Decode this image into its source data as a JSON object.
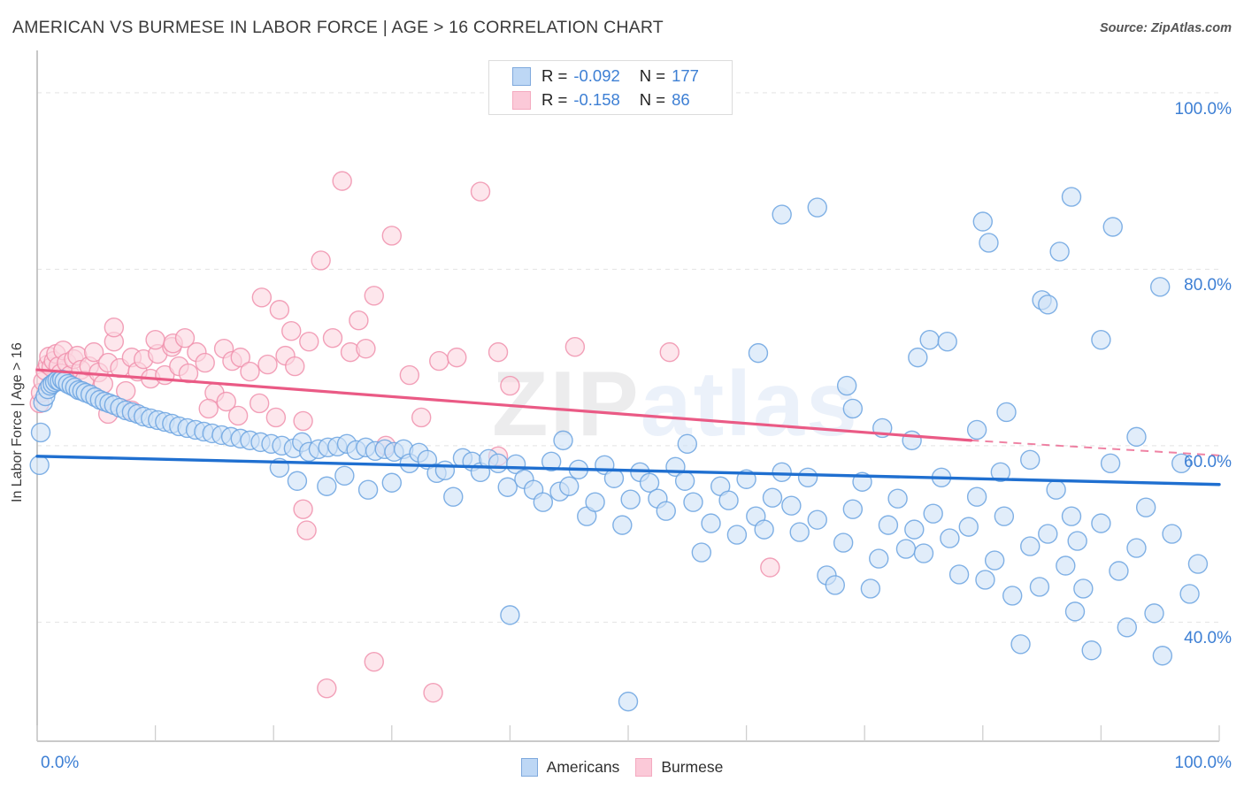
{
  "header": {
    "title": "AMERICAN VS BURMESE IN LABOR FORCE | AGE > 16 CORRELATION CHART",
    "source": "Source: ZipAtlas.com"
  },
  "watermark": {
    "zip": "ZIP",
    "atlas": "atlas"
  },
  "axes": {
    "y_title": "In Labor Force | Age > 16",
    "x_min_label": "0.0%",
    "x_max_label": "100.0%",
    "y_tick_labels": [
      "100.0%",
      "80.0%",
      "60.0%",
      "40.0%"
    ]
  },
  "stats_legend": {
    "r_label": "R =",
    "n_label": "N =",
    "rows": [
      {
        "series": "Americans",
        "color": "#bdd7f5",
        "r": "-0.092",
        "n": "177"
      },
      {
        "series": "Burmese",
        "color": "#fbc9d8",
        "r": "-0.158",
        "n": "86"
      }
    ]
  },
  "series_legend": [
    {
      "label": "Americans",
      "color": "#bdd7f5"
    },
    {
      "label": "Burmese",
      "color": "#fbc9d8"
    }
  ],
  "colors": {
    "blue_fill": "#cfe2f7",
    "blue_stroke": "#6ba3e0",
    "pink_fill": "#fbd6e0",
    "pink_stroke": "#f090ad",
    "blue_trend": "#1f6fd0",
    "pink_trend": "#ea5a85",
    "axis_text": "#3d7fd4",
    "gridline": "#e3e3e3"
  },
  "chart_data": {
    "type": "scatter",
    "title": "AMERICAN VS BURMESE IN LABOR FORCE | AGE > 16 CORRELATION CHART",
    "xlabel": "",
    "ylabel": "In Labor Force | Age > 16",
    "xlim": [
      0,
      100
    ],
    "ylim": [
      26.5,
      104.5
    ],
    "xticks": [
      0,
      100
    ],
    "yticks": [
      40,
      60,
      80,
      100
    ],
    "grid": "horizontal-dashed",
    "legend_position": "bottom-center",
    "series": [
      {
        "name": "Americans",
        "color": "#cfe2f7",
        "stroke": "#6ba3e0",
        "r": -0.092,
        "n": 177,
        "trendline": {
          "x0": 0,
          "y0": 58.8,
          "x1": 100,
          "y1": 55.6,
          "style": "solid"
        },
        "points": [
          [
            0.2,
            57.8
          ],
          [
            0.3,
            61.5
          ],
          [
            0.5,
            64.9
          ],
          [
            0.7,
            65.6
          ],
          [
            0.9,
            66.4
          ],
          [
            1.1,
            66.8
          ],
          [
            1.3,
            67.0
          ],
          [
            1.5,
            67.2
          ],
          [
            1.7,
            67.4
          ],
          [
            1.9,
            67.3
          ],
          [
            2.1,
            67.5
          ],
          [
            2.3,
            67.3
          ],
          [
            2.6,
            67.0
          ],
          [
            2.9,
            66.8
          ],
          [
            3.2,
            66.6
          ],
          [
            3.5,
            66.3
          ],
          [
            3.8,
            66.2
          ],
          [
            4.1,
            66.0
          ],
          [
            4.5,
            65.8
          ],
          [
            4.9,
            65.5
          ],
          [
            5.3,
            65.2
          ],
          [
            5.7,
            65.0
          ],
          [
            6.1,
            64.8
          ],
          [
            6.5,
            64.6
          ],
          [
            7.0,
            64.3
          ],
          [
            7.5,
            64.0
          ],
          [
            8.0,
            63.8
          ],
          [
            8.5,
            63.6
          ],
          [
            9.0,
            63.3
          ],
          [
            9.6,
            63.1
          ],
          [
            10.2,
            62.9
          ],
          [
            10.8,
            62.7
          ],
          [
            11.4,
            62.5
          ],
          [
            12.0,
            62.2
          ],
          [
            12.7,
            62.0
          ],
          [
            13.4,
            61.8
          ],
          [
            14.1,
            61.6
          ],
          [
            14.8,
            61.4
          ],
          [
            15.6,
            61.2
          ],
          [
            16.4,
            61.0
          ],
          [
            17.2,
            60.8
          ],
          [
            18.0,
            60.6
          ],
          [
            18.9,
            60.4
          ],
          [
            19.8,
            60.2
          ],
          [
            20.7,
            60.0
          ],
          [
            21.7,
            59.7
          ],
          [
            22.4,
            60.4
          ],
          [
            23.0,
            59.3
          ],
          [
            23.8,
            59.6
          ],
          [
            24.6,
            59.8
          ],
          [
            25.4,
            59.9
          ],
          [
            26.2,
            60.2
          ],
          [
            27.0,
            59.5
          ],
          [
            27.8,
            59.8
          ],
          [
            28.6,
            59.4
          ],
          [
            29.4,
            59.6
          ],
          [
            30.2,
            59.3
          ],
          [
            31.0,
            59.6
          ],
          [
            20.5,
            57.5
          ],
          [
            22.0,
            56.0
          ],
          [
            24.5,
            55.4
          ],
          [
            26.0,
            56.6
          ],
          [
            28.0,
            55.0
          ],
          [
            30.0,
            55.8
          ],
          [
            31.5,
            58.0
          ],
          [
            32.3,
            59.2
          ],
          [
            33.0,
            58.4
          ],
          [
            33.8,
            56.9
          ],
          [
            34.5,
            57.2
          ],
          [
            35.2,
            54.2
          ],
          [
            36.0,
            58.6
          ],
          [
            36.8,
            58.2
          ],
          [
            37.5,
            57.0
          ],
          [
            38.2,
            58.5
          ],
          [
            39.0,
            58.0
          ],
          [
            39.8,
            55.3
          ],
          [
            40.5,
            57.9
          ],
          [
            41.2,
            56.2
          ],
          [
            42.0,
            55.0
          ],
          [
            42.8,
            53.6
          ],
          [
            43.5,
            58.2
          ],
          [
            44.2,
            54.8
          ],
          [
            45.0,
            55.4
          ],
          [
            45.8,
            57.3
          ],
          [
            46.5,
            52.0
          ],
          [
            47.2,
            53.6
          ],
          [
            48.0,
            57.8
          ],
          [
            48.8,
            56.3
          ],
          [
            49.5,
            51.0
          ],
          [
            50.2,
            53.9
          ],
          [
            51.0,
            57.0
          ],
          [
            51.8,
            55.8
          ],
          [
            52.5,
            54.0
          ],
          [
            53.2,
            52.6
          ],
          [
            54.0,
            57.6
          ],
          [
            54.8,
            56.0
          ],
          [
            55.5,
            53.6
          ],
          [
            56.2,
            47.9
          ],
          [
            57.0,
            51.2
          ],
          [
            57.8,
            55.4
          ],
          [
            58.5,
            53.8
          ],
          [
            59.2,
            49.9
          ],
          [
            60.0,
            56.2
          ],
          [
            60.8,
            52.0
          ],
          [
            61.5,
            50.5
          ],
          [
            62.2,
            54.1
          ],
          [
            63.0,
            57.0
          ],
          [
            63.8,
            53.2
          ],
          [
            64.5,
            50.2
          ],
          [
            65.2,
            56.4
          ],
          [
            66.0,
            51.6
          ],
          [
            66.8,
            45.3
          ],
          [
            67.5,
            44.2
          ],
          [
            68.2,
            49.0
          ],
          [
            69.0,
            52.8
          ],
          [
            69.8,
            55.9
          ],
          [
            70.5,
            43.8
          ],
          [
            71.2,
            47.2
          ],
          [
            72.0,
            51.0
          ],
          [
            72.8,
            54.0
          ],
          [
            73.5,
            48.3
          ],
          [
            74.2,
            50.5
          ],
          [
            75.0,
            47.8
          ],
          [
            75.8,
            52.3
          ],
          [
            76.5,
            56.4
          ],
          [
            77.2,
            49.5
          ],
          [
            78.0,
            45.4
          ],
          [
            78.8,
            50.8
          ],
          [
            79.5,
            54.2
          ],
          [
            80.2,
            44.8
          ],
          [
            81.0,
            47.0
          ],
          [
            81.8,
            52.0
          ],
          [
            82.5,
            43.0
          ],
          [
            83.2,
            37.5
          ],
          [
            84.0,
            48.6
          ],
          [
            84.8,
            44.0
          ],
          [
            85.5,
            50.0
          ],
          [
            86.2,
            55.0
          ],
          [
            87.0,
            46.4
          ],
          [
            87.8,
            41.2
          ],
          [
            88.5,
            43.8
          ],
          [
            89.2,
            36.8
          ],
          [
            90.0,
            51.2
          ],
          [
            90.8,
            58.0
          ],
          [
            91.5,
            45.8
          ],
          [
            92.2,
            39.4
          ],
          [
            93.0,
            48.4
          ],
          [
            93.8,
            53.0
          ],
          [
            94.5,
            41.0
          ],
          [
            95.2,
            36.2
          ],
          [
            96.0,
            50.0
          ],
          [
            96.8,
            58.0
          ],
          [
            97.5,
            43.2
          ],
          [
            98.2,
            46.6
          ],
          [
            61.0,
            70.5
          ],
          [
            63.0,
            86.2
          ],
          [
            66.0,
            87.0
          ],
          [
            68.5,
            66.8
          ],
          [
            69.0,
            64.2
          ],
          [
            71.5,
            62.0
          ],
          [
            74.5,
            70.0
          ],
          [
            75.5,
            72.0
          ],
          [
            77.0,
            71.8
          ],
          [
            80.0,
            85.4
          ],
          [
            80.5,
            83.0
          ],
          [
            82.0,
            63.8
          ],
          [
            85.0,
            76.5
          ],
          [
            85.5,
            76.0
          ],
          [
            86.5,
            82.0
          ],
          [
            87.5,
            88.2
          ],
          [
            90.0,
            72.0
          ],
          [
            91.0,
            84.8
          ],
          [
            93.0,
            61.0
          ],
          [
            95.0,
            78.0
          ],
          [
            40.0,
            40.8
          ],
          [
            50.0,
            31.0
          ],
          [
            87.5,
            52.0
          ],
          [
            88.0,
            49.2
          ],
          [
            74.0,
            60.6
          ],
          [
            79.5,
            61.8
          ],
          [
            81.5,
            57.0
          ],
          [
            84.0,
            58.4
          ],
          [
            55.0,
            60.2
          ],
          [
            44.5,
            60.6
          ]
        ]
      },
      {
        "name": "Burmese",
        "color": "#fbd6e0",
        "stroke": "#f090ad",
        "r": -0.158,
        "n": 86,
        "trendline": {
          "x0": 0,
          "y0": 68.6,
          "x1": 79,
          "y1": 60.6,
          "style": "solid-then-dashed",
          "dash_from_x": 79,
          "dash_to_x": 100,
          "dash_y1": 58.9
        },
        "points": [
          [
            0.2,
            64.8
          ],
          [
            0.3,
            66.0
          ],
          [
            0.5,
            67.3
          ],
          [
            0.7,
            68.5
          ],
          [
            0.9,
            69.2
          ],
          [
            1.0,
            70.1
          ],
          [
            1.2,
            68.9
          ],
          [
            1.4,
            69.6
          ],
          [
            1.6,
            70.4
          ],
          [
            1.8,
            69.0
          ],
          [
            2.0,
            68.2
          ],
          [
            2.2,
            70.8
          ],
          [
            2.5,
            69.4
          ],
          [
            2.8,
            68.0
          ],
          [
            3.1,
            69.8
          ],
          [
            3.4,
            70.2
          ],
          [
            3.7,
            68.6
          ],
          [
            4.0,
            67.4
          ],
          [
            4.4,
            69.0
          ],
          [
            4.8,
            70.6
          ],
          [
            5.2,
            68.3
          ],
          [
            5.6,
            67.0
          ],
          [
            6.0,
            69.4
          ],
          [
            6.5,
            71.8
          ],
          [
            7.0,
            68.8
          ],
          [
            7.5,
            66.2
          ],
          [
            8.0,
            70.0
          ],
          [
            8.5,
            68.4
          ],
          [
            9.0,
            69.8
          ],
          [
            9.6,
            67.6
          ],
          [
            10.2,
            70.4
          ],
          [
            10.8,
            68.0
          ],
          [
            11.4,
            71.2
          ],
          [
            12.0,
            69.0
          ],
          [
            12.8,
            68.2
          ],
          [
            13.5,
            70.6
          ],
          [
            14.2,
            69.4
          ],
          [
            15.0,
            66.0
          ],
          [
            15.8,
            71.0
          ],
          [
            16.5,
            69.6
          ],
          [
            17.2,
            70.0
          ],
          [
            18.0,
            68.4
          ],
          [
            18.8,
            64.8
          ],
          [
            19.5,
            69.2
          ],
          [
            20.2,
            63.2
          ],
          [
            21.0,
            70.2
          ],
          [
            21.8,
            69.0
          ],
          [
            22.5,
            62.8
          ],
          [
            6.5,
            73.4
          ],
          [
            10.0,
            72.0
          ],
          [
            11.5,
            71.6
          ],
          [
            12.5,
            72.2
          ],
          [
            19.0,
            76.8
          ],
          [
            20.5,
            75.4
          ],
          [
            21.5,
            73.0
          ],
          [
            23.0,
            71.8
          ],
          [
            24.0,
            81.0
          ],
          [
            25.0,
            72.2
          ],
          [
            25.8,
            90.0
          ],
          [
            26.5,
            70.6
          ],
          [
            27.2,
            74.2
          ],
          [
            27.8,
            71.0
          ],
          [
            28.5,
            77.0
          ],
          [
            30.0,
            83.8
          ],
          [
            31.5,
            68.0
          ],
          [
            32.5,
            63.2
          ],
          [
            34.0,
            69.6
          ],
          [
            35.5,
            70.0
          ],
          [
            37.5,
            88.8
          ],
          [
            39.0,
            70.6
          ],
          [
            40.0,
            66.8
          ],
          [
            45.5,
            71.2
          ],
          [
            53.5,
            70.6
          ],
          [
            39.0,
            58.8
          ],
          [
            22.5,
            52.8
          ],
          [
            22.8,
            50.4
          ],
          [
            24.5,
            32.5
          ],
          [
            28.5,
            35.5
          ],
          [
            33.5,
            32.0
          ],
          [
            17.0,
            63.4
          ],
          [
            14.5,
            64.2
          ],
          [
            16.0,
            65.0
          ],
          [
            8.0,
            64.0
          ],
          [
            6.0,
            63.6
          ],
          [
            62.0,
            46.2
          ],
          [
            29.5,
            60.0
          ]
        ]
      }
    ]
  }
}
